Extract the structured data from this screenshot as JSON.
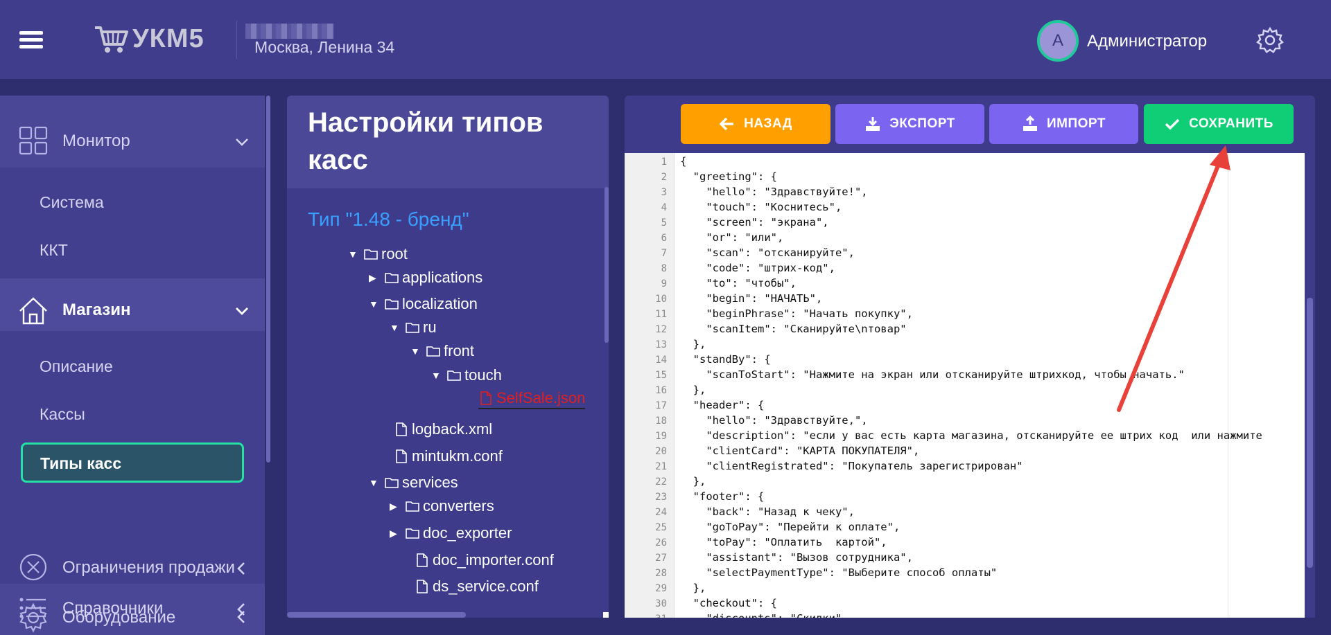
{
  "header": {
    "logo_text": "УКМ5",
    "store_address": "Москва, Ленина 34",
    "avatar_letter": "A",
    "username": "Администратор"
  },
  "sidebar": {
    "monitor": "Монитор",
    "sistema": "Система",
    "kkt": "ККТ",
    "magazin": "Магазин",
    "opisanie": "Описание",
    "kassy": "Кассы",
    "tipy_kass": "Типы касс",
    "spravochniki": "Справочники",
    "ogranicheniya": "Ограничения продажи",
    "oborudovanie": "Оборудование"
  },
  "tree": {
    "title": "Настройки типов касс",
    "type_label": "Тип \"1.48 - бренд\"",
    "nodes": {
      "root": "root",
      "applications": "applications",
      "localization": "localization",
      "ru": "ru",
      "front": "front",
      "touch": "touch",
      "selfsale": "SelfSale.json",
      "logback": "logback.xml",
      "mintukm": "mintukm.conf",
      "services": "services",
      "converters": "converters",
      "doc_exporter": "doc_exporter",
      "doc_importer": "doc_importer.conf",
      "ds_service": "ds_service.conf"
    }
  },
  "toolbar": {
    "back": "НАЗАД",
    "export": "ЭКСПОРТ",
    "import": "ИМПОРТ",
    "save": "СОХРАНИТЬ"
  },
  "editor": {
    "line_numbers": [
      "1",
      "2",
      "3",
      "4",
      "5",
      "6",
      "7",
      "8",
      "9",
      "10",
      "11",
      "12",
      "13",
      "14",
      "15",
      "16",
      "17",
      "18",
      "19",
      "20",
      "21",
      "22",
      "23",
      "24",
      "25",
      "26",
      "27",
      "28",
      "29",
      "30",
      "31"
    ],
    "lines": [
      "{",
      "  \"greeting\": {",
      "    \"hello\": \"Здравствуйте!\",",
      "    \"touch\": \"Коснитесь\",",
      "    \"screen\": \"экрана\",",
      "    \"or\": \"или\",",
      "    \"scan\": \"отсканируйте\",",
      "    \"code\": \"штрих-код\",",
      "    \"to\": \"чтобы\",",
      "    \"begin\": \"НАЧАТЬ\",",
      "    \"beginPhrase\": \"Начать покупку\",",
      "    \"scanItem\": \"Сканируйте\\nтовар\"",
      "  },",
      "  \"standBy\": {",
      "    \"scanToStart\": \"Нажмите на экран или отсканируйте штрихкод, чтобы начать.\"",
      "  },",
      "  \"header\": {",
      "    \"hello\": \"Здравствуйте,\",",
      "    \"description\": \"если у вас есть карта магазина, отсканируйте ее штрих код  или нажмите",
      "    \"clientCard\": \"КАРТА ПОКУПАТЕЛЯ\",",
      "    \"clientRegistrated\": \"Покупатель зарегистрирован\"",
      "  },",
      "  \"footer\": {",
      "    \"back\": \"Назад к чеку\",",
      "    \"goToPay\": \"Перейти к оплате\",",
      "    \"toPay\": \"Оплатить  картой\",",
      "    \"assistant\": \"Вызов сотрудника\",",
      "    \"selectPaymentType\": \"Выберите способ оплаты\"",
      "  },",
      "  \"checkout\": {",
      "    \"discounts\": \"Скидки\","
    ]
  },
  "colors": {
    "header_bg": "#403d8c",
    "sidebar_bg": "#4a4796",
    "accent_green": "#0fce76",
    "accent_orange": "#ff9f00",
    "accent_purple": "#7b64f0",
    "annotation_arrow": "#e8413a"
  }
}
